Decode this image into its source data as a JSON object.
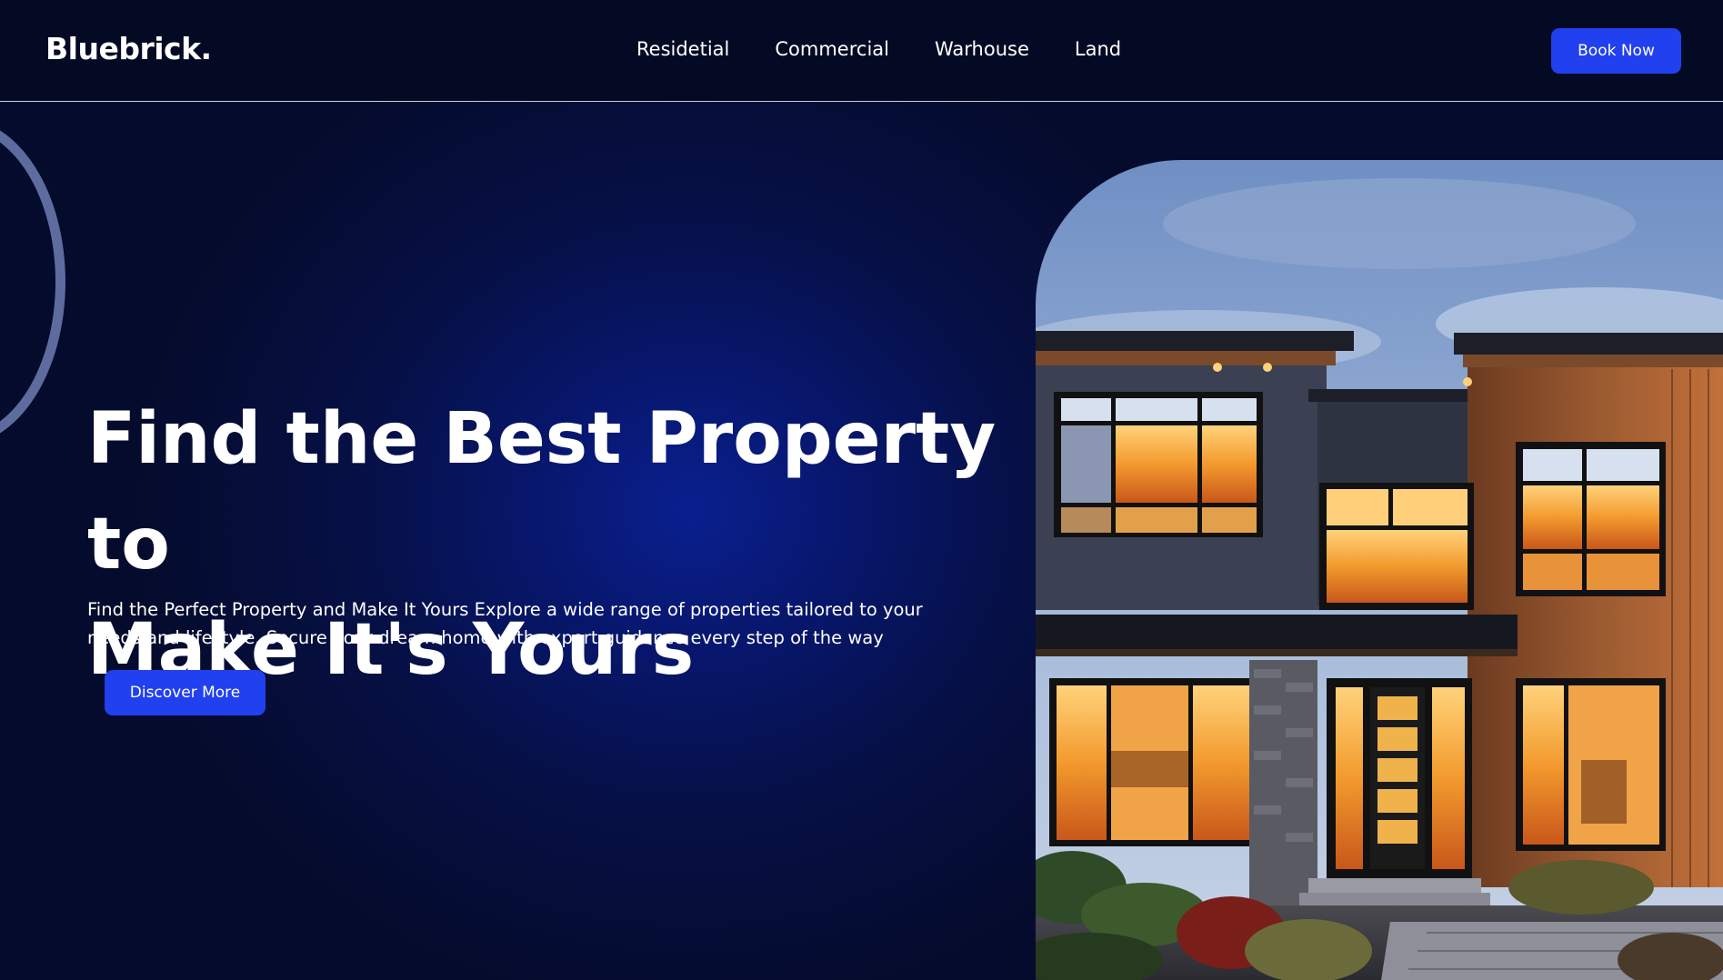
{
  "header": {
    "logo": "Bluebrick.",
    "nav": [
      "Residetial",
      "Commercial",
      "Warhouse",
      "Land"
    ],
    "book_button": "Book Now"
  },
  "hero": {
    "title_line1": "Find the Best Property to",
    "title_line2": "Make It's Yours",
    "description_line1": "Find the Perfect Property and Make It Yours Explore a wide range of properties tailored to your",
    "description_line2": "needs and lifestyle. Secure your dream home with expert guidance every step of the way",
    "cta_button": "Discover More"
  },
  "colors": {
    "background": "#050b2c",
    "accent": "#2140f0",
    "glow": "#0a1f8f"
  }
}
